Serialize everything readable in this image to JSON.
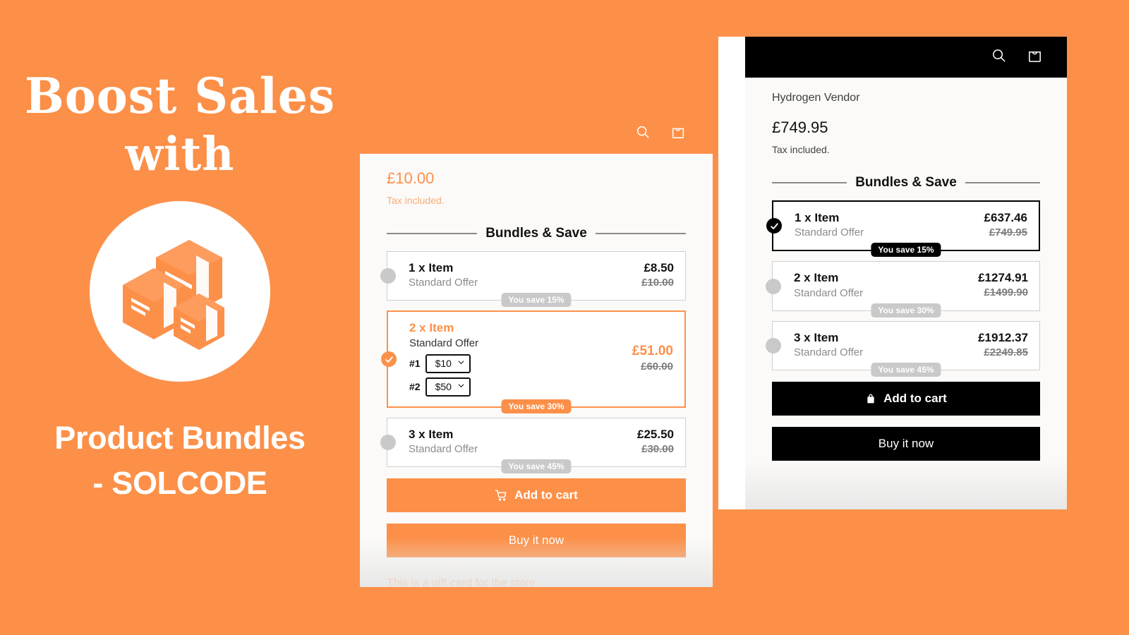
{
  "promo": {
    "headline_line1": "Boost Sales",
    "headline_line2": "with",
    "logo_icon": "boxes-packages-icon",
    "title_line1": "Product Bundles",
    "title_line2": "- SOLCODE"
  },
  "colors": {
    "background_orange": "#FC9049",
    "accent_orange": "#FC9049",
    "accent_black": "#000000",
    "muted_gray": "#c9c9c9",
    "card_bg": "#FBFAF8"
  },
  "left_mockup": {
    "topbar": {
      "search_icon": "search-icon",
      "cart_icon": "shopping-bag-icon"
    },
    "price": "£10.00",
    "tax_note": "Tax included.",
    "section_title": "Bundles & Save",
    "options": [
      {
        "name": "1 x Item",
        "subtitle": "Standard Offer",
        "price_new": "£8.50",
        "price_old": "£10.00",
        "badge": "You save 15%",
        "selected": false
      },
      {
        "name": "2 x Item",
        "subtitle": "Standard Offer",
        "price_new": "£51.00",
        "price_old": "£60.00",
        "badge": "You save 30%",
        "selected": true,
        "variants": [
          {
            "label": "#1",
            "value": "$10",
            "options": [
              "$10",
              "$50"
            ]
          },
          {
            "label": "#2",
            "value": "$50",
            "options": [
              "$10",
              "$50"
            ]
          }
        ]
      },
      {
        "name": "3 x Item",
        "subtitle": "Standard Offer",
        "price_new": "£25.50",
        "price_old": "£30.00",
        "badge": "You save 45%",
        "selected": false
      }
    ],
    "add_to_cart_label": "Add to cart",
    "add_to_cart_icon": "shopping-cart-icon",
    "buy_now_label": "Buy it now",
    "gift_note": "This is a gift card for the store"
  },
  "right_mockup": {
    "topbar": {
      "search_icon": "search-icon",
      "cart_icon": "shopping-bag-icon"
    },
    "vendor": "Hydrogen Vendor",
    "price": "£749.95",
    "tax_note": "Tax included.",
    "section_title": "Bundles & Save",
    "options": [
      {
        "name": "1 x Item",
        "subtitle": "Standard Offer",
        "price_new": "£637.46",
        "price_old": "£749.95",
        "badge": "You save 15%",
        "selected": true
      },
      {
        "name": "2 x Item",
        "subtitle": "Standard Offer",
        "price_new": "£1274.91",
        "price_old": "£1499.90",
        "badge": "You save 30%",
        "selected": false
      },
      {
        "name": "3 x Item",
        "subtitle": "Standard Offer",
        "price_new": "£1912.37",
        "price_old": "£2249.85",
        "badge": "You save 45%",
        "selected": false
      }
    ],
    "add_to_cart_label": "Add to cart",
    "add_to_cart_icon": "shopping-bag-icon",
    "buy_now_label": "Buy it now"
  }
}
